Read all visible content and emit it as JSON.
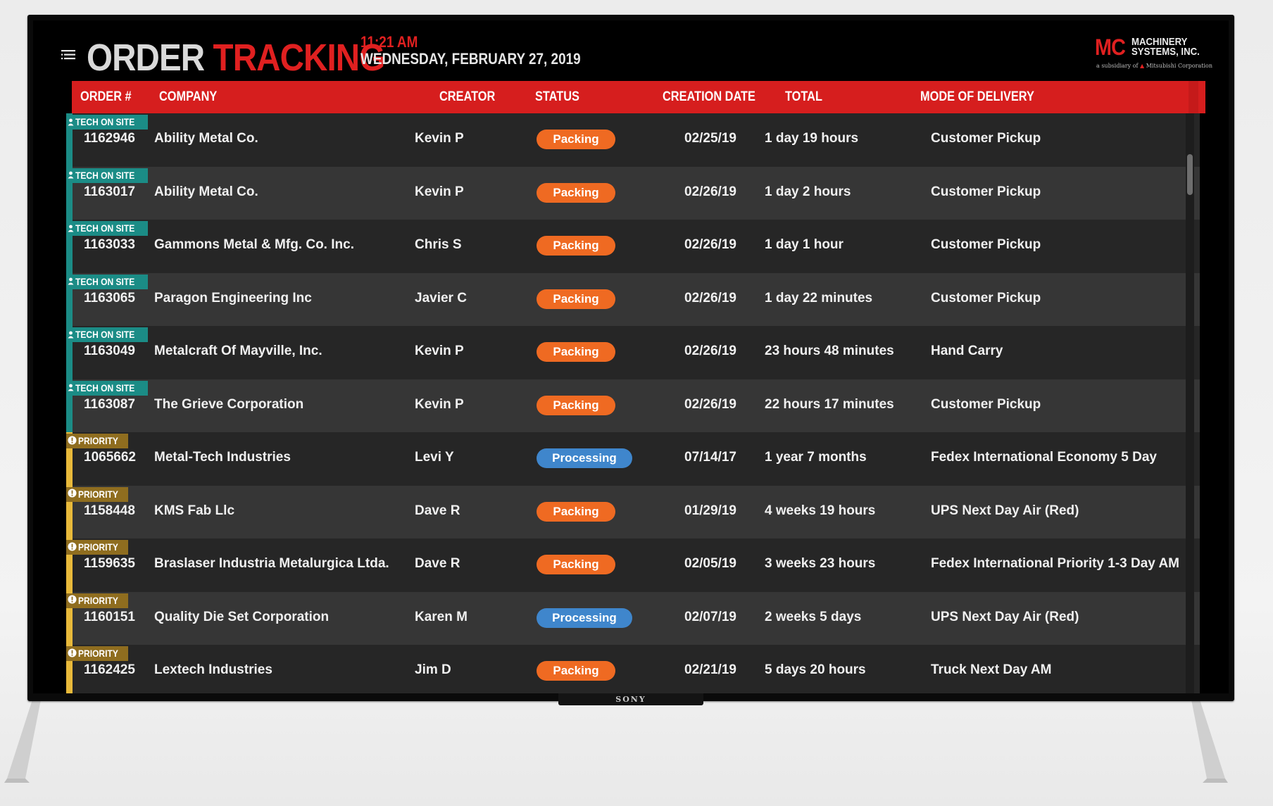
{
  "header": {
    "title_part1": "ORDER",
    "title_part2": "TRACKING",
    "time": "11:21 AM",
    "date": "WEDNESDAY, FEBRUARY 27, 2019"
  },
  "logo": {
    "mc": "MC",
    "line1": "MACHINERY",
    "line2": "SYSTEMS, INC.",
    "subsidiary_prefix": "a subsidiary of",
    "subsidiary_name": "Mitsubishi Corporation"
  },
  "device": {
    "brand": "SONY"
  },
  "columns": {
    "order": "ORDER #",
    "company": "COMPANY",
    "creator": "CREATOR",
    "status": "STATUS",
    "creation_date": "CREATION DATE",
    "total": "TOTAL",
    "delivery": "MODE OF DELIVERY"
  },
  "colors": {
    "accent_red": "#e02020",
    "tech_on_site": "#1b8c86",
    "priority": "#e8b93a",
    "packing": "#ef6a22",
    "processing": "#3f86cc"
  },
  "rows": [
    {
      "badge_type": "tech",
      "badge": "TECH ON SITE",
      "order": "1162946",
      "company": "Ability Metal Co.",
      "creator": "Kevin P",
      "status": "Packing",
      "status_type": "packing",
      "date": "02/25/19",
      "total": "1 day 19 hours",
      "delivery": "Customer Pickup"
    },
    {
      "badge_type": "tech",
      "badge": "TECH ON SITE",
      "order": "1163017",
      "company": "Ability Metal Co.",
      "creator": "Kevin P",
      "status": "Packing",
      "status_type": "packing",
      "date": "02/26/19",
      "total": "1 day 2 hours",
      "delivery": "Customer Pickup"
    },
    {
      "badge_type": "tech",
      "badge": "TECH ON SITE",
      "order": "1163033",
      "company": "Gammons Metal & Mfg. Co. Inc.",
      "creator": "Chris S",
      "status": "Packing",
      "status_type": "packing",
      "date": "02/26/19",
      "total": "1 day 1 hour",
      "delivery": "Customer Pickup"
    },
    {
      "badge_type": "tech",
      "badge": "TECH ON SITE",
      "order": "1163065",
      "company": "Paragon Engineering Inc",
      "creator": "Javier C",
      "status": "Packing",
      "status_type": "packing",
      "date": "02/26/19",
      "total": "1 day 22 minutes",
      "delivery": "Customer Pickup"
    },
    {
      "badge_type": "tech",
      "badge": "TECH ON SITE",
      "order": "1163049",
      "company": "Metalcraft Of Mayville, Inc.",
      "creator": "Kevin P",
      "status": "Packing",
      "status_type": "packing",
      "date": "02/26/19",
      "total": "23 hours 48 minutes",
      "delivery": "Hand Carry"
    },
    {
      "badge_type": "tech",
      "badge": "TECH ON SITE",
      "order": "1163087",
      "company": "The Grieve Corporation",
      "creator": "Kevin P",
      "status": "Packing",
      "status_type": "packing",
      "date": "02/26/19",
      "total": "22 hours 17 minutes",
      "delivery": "Customer Pickup"
    },
    {
      "badge_type": "priority",
      "badge": "PRIORITY",
      "order": "1065662",
      "company": "Metal-Tech Industries",
      "creator": "Levi Y",
      "status": "Processing",
      "status_type": "processing",
      "date": "07/14/17",
      "total": "1 year 7 months",
      "delivery": "Fedex International Economy 5 Day"
    },
    {
      "badge_type": "priority",
      "badge": "PRIORITY",
      "order": "1158448",
      "company": "KMS Fab Llc",
      "creator": "Dave R",
      "status": "Packing",
      "status_type": "packing",
      "date": "01/29/19",
      "total": "4 weeks 19 hours",
      "delivery": "UPS Next Day Air (Red)"
    },
    {
      "badge_type": "priority",
      "badge": "PRIORITY",
      "order": "1159635",
      "company": "Braslaser Industria Metalurgica Ltda.",
      "creator": "Dave R",
      "status": "Packing",
      "status_type": "packing",
      "date": "02/05/19",
      "total": "3 weeks 23 hours",
      "delivery": "Fedex International Priority 1-3 Day AM"
    },
    {
      "badge_type": "priority",
      "badge": "PRIORITY",
      "order": "1160151",
      "company": "Quality Die Set Corporation",
      "creator": "Karen M",
      "status": "Processing",
      "status_type": "processing",
      "date": "02/07/19",
      "total": "2 weeks 5 days",
      "delivery": "UPS Next Day Air (Red)"
    },
    {
      "badge_type": "priority",
      "badge": "PRIORITY",
      "order": "1162425",
      "company": "Lextech Industries",
      "creator": "Jim D",
      "status": "Packing",
      "status_type": "packing",
      "date": "02/21/19",
      "total": "5 days 20 hours",
      "delivery": "Truck Next Day AM"
    }
  ]
}
